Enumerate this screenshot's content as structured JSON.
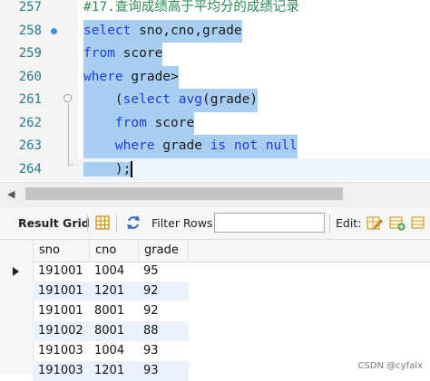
{
  "editor": {
    "lines": [
      {
        "num": "257",
        "segments": [
          {
            "t": "#17.查询成绩高于平均分的成绩记录",
            "c": "cm"
          }
        ]
      },
      {
        "num": "258",
        "segments": [
          {
            "t": "select sno,cno,grade",
            "c": "kwmix"
          }
        ]
      },
      {
        "num": "259",
        "segments": [
          {
            "t": "from score",
            "c": "kwmix"
          }
        ]
      },
      {
        "num": "260",
        "segments": [
          {
            "t": "where grade>",
            "c": "kwmix"
          }
        ]
      },
      {
        "num": "261",
        "segments": [
          {
            "t": "    (select avg(grade)",
            "c": "kwmix"
          }
        ]
      },
      {
        "num": "262",
        "segments": [
          {
            "t": "    from score",
            "c": "kwmix"
          }
        ]
      },
      {
        "num": "263",
        "segments": [
          {
            "t": "    where grade is not null",
            "c": "kwmix"
          }
        ]
      },
      {
        "num": "264",
        "segments": [
          {
            "t": "    );",
            "c": "kwmix"
          }
        ]
      }
    ]
  },
  "toolbar": {
    "result_grid_label": "Result Grid",
    "filter_rows_label": "Filter Rows:",
    "filter_value": "",
    "edit_label": "Edit:"
  },
  "grid": {
    "columns": [
      "sno",
      "cno",
      "grade"
    ],
    "rows": [
      [
        "191001",
        "1004",
        "95"
      ],
      [
        "191001",
        "1201",
        "92"
      ],
      [
        "191001",
        "8001",
        "92"
      ],
      [
        "191002",
        "8001",
        "88"
      ],
      [
        "191003",
        "1004",
        "93"
      ],
      [
        "191003",
        "1201",
        "93"
      ]
    ],
    "selected_row": 0
  },
  "watermark": "CSDN @cyfalx",
  "colors": {
    "selection": "#a8cff1",
    "keyword": "#1f3fd4",
    "comment": "#2e8b57",
    "line_number": "#2b7a8c",
    "alt_row": "#eaf3fc"
  }
}
